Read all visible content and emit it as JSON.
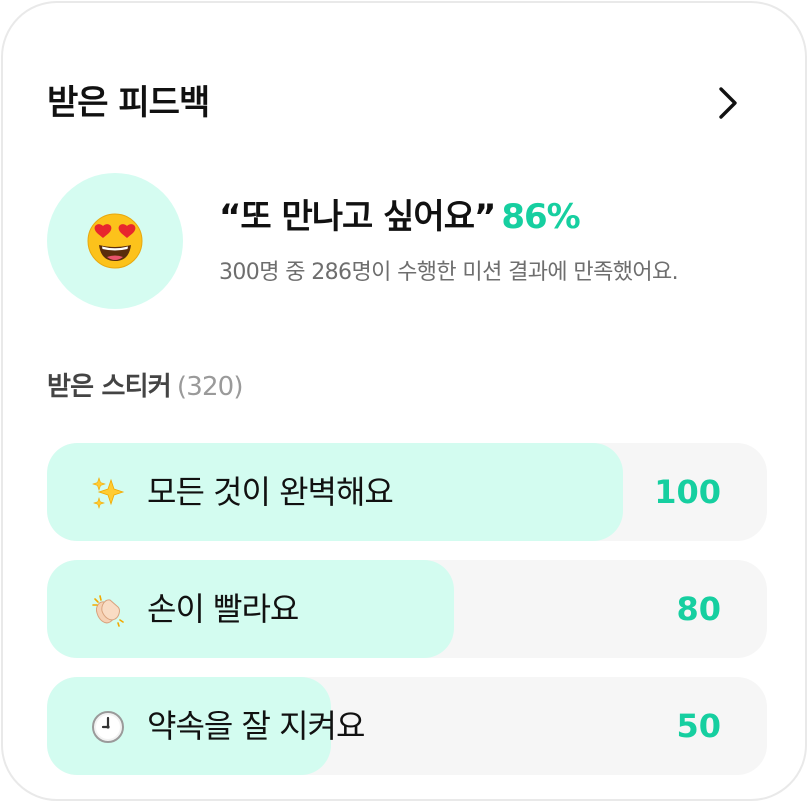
{
  "header": {
    "title": "받은 피드백",
    "chevron_icon": "chevron-right-icon"
  },
  "summary": {
    "emoji_icon": "heart-eyes-face-icon",
    "quote": "“또 만나고 싶어요”",
    "percent": "86%",
    "description": "300명 중 286명이 수행한 미션 결과에 만족했어요."
  },
  "stickers": {
    "title": "받은 스티커",
    "count_label": "(320)",
    "items": [
      {
        "icon": "sparkles-icon",
        "label": "모든 것이 완벽해요",
        "count": "100",
        "fill_ratio": 0.8
      },
      {
        "icon": "clapping-hands-icon",
        "label": "손이 빨라요",
        "count": "80",
        "fill_ratio": 0.565
      },
      {
        "icon": "clock-icon",
        "label": "약속을 잘 지켜요",
        "count": "50",
        "fill_ratio": 0.395
      }
    ]
  },
  "colors": {
    "accent": "#16cfa0",
    "fill": "#d3fcf0",
    "track": "#f6f6f6",
    "emoji_bg": "#d5fcf1"
  }
}
